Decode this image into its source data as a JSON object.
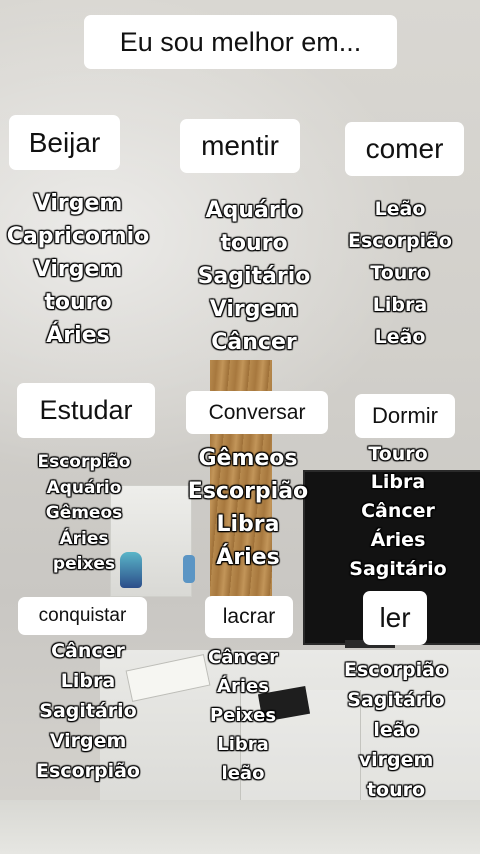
{
  "title": "Eu sou melhor em...",
  "categories": [
    {
      "label": "Beijar",
      "signs": [
        "Virgem",
        "Capricornio",
        "Virgem",
        "touro",
        "Áries"
      ]
    },
    {
      "label": "mentir",
      "signs": [
        "Aquário",
        "touro",
        "Sagitário",
        "Virgem",
        "Câncer"
      ]
    },
    {
      "label": "comer",
      "signs": [
        "Leão",
        "Escorpião",
        "Touro",
        "Libra",
        "Leão"
      ]
    },
    {
      "label": "Estudar",
      "signs": [
        "Escorpião",
        "Aquário",
        "Gêmeos",
        "Áries",
        "peixes"
      ]
    },
    {
      "label": "Conversar",
      "signs": [
        "Gêmeos",
        "Escorpião",
        "Libra",
        "Áries"
      ]
    },
    {
      "label": "Dormir",
      "signs": [
        "Touro",
        "Libra",
        "Câncer",
        "Áries",
        "Sagitário"
      ]
    },
    {
      "label": "conquistar",
      "signs": [
        "Câncer",
        "Libra",
        "Sagitário",
        "Virgem",
        "Escorpião"
      ]
    },
    {
      "label": "lacrar",
      "signs": [
        "Câncer",
        "Áries",
        "Peixes",
        "Libra",
        "leão"
      ]
    },
    {
      "label": "ler",
      "signs": [
        "Escorpião",
        "Sagitário",
        "leão",
        "virgem",
        "touro"
      ]
    }
  ]
}
